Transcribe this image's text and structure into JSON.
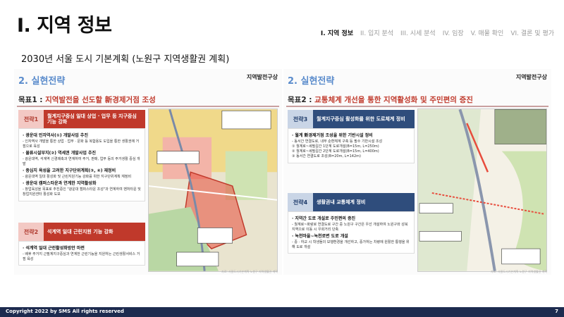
{
  "header": {
    "title": "I. 지역 정보"
  },
  "nav": [
    "I. 지역 정보",
    "II. 입지 분석",
    "III. 시세 분석",
    "IV. 임장",
    "V. 매물 확인",
    "VI. 결론 및 평가"
  ],
  "subtitle": "2030년 서울 도시 기본계획 (노원구 지역생활권 계획)",
  "left": {
    "heading": "2. 실현전략",
    "tag": "지역발전구상",
    "goal_prefix": "목표1 : ",
    "goal_text": "지역발전을 선도할 新경제거점 조성",
    "s1_tag": "전략1",
    "s1_title": "월계지구중심 일대 상업 · 업무 등 지구중심 기능 강화",
    "s1_b1": "· 광운대 민자역사(①) 개발사업 추진",
    "s1_b1d": "- 인자역사 개발을 통한 상업 · 업무 · 문화 등 복합용도 도입을 통한 생활권에 거점으로 육성",
    "s1_b2": "· 물류시설부지(②) 역세권 개발사업 추진",
    "s1_b2d": "- 광운대역, 석계역 신경제축과 연계하여 주거, 판매, 업무 등의 주거생활 중심 개발",
    "s1_b3": "· 중심지 육성을 고려한 지구단위계획(③, ④) 재정비",
    "s1_b3d": "- 광운대역 일대 활성화 및 근린지원기능 강화를 위한 지구단위계획 재정비",
    "s1_b4": "· 광운대 캠퍼스타운과 연계한 지역활성화",
    "s1_b4d": "- 창업육성을 목표로 추진중인 \"광운대 캠퍼스타운 조성\"과 연계하여 벤처타운 및 창업지원센터 활성화 도모",
    "s2_tag": "전략2",
    "s2_title": "석계역 일대 근린지원 기능 강화",
    "s2_b1": "· 석계역 일대 근린활성화방안 마련",
    "s2_b1d": "- 배후 주거지 근필계지구중심과 연계한 근린기능을 지원하는 근린생활서비스 거점 육성"
  },
  "right": {
    "heading": "2. 실현전략",
    "tag": "지역발전구상",
    "goal_prefix": "목표2 : ",
    "goal_text": "교통체계 개선을 통한 지역활성화 및 주민편의 증진",
    "s3_tag": "전략3",
    "s3_title": "월계지구중심 활성화를 위한 도로체계 정비",
    "s3_b1": "· 월계 新경제거점 조성을 위한 기반시설 정비",
    "s3_b1d": "- 동서간 연결도로, 내부 순환체계 구축 등 필수 기반시설 조성",
    "s3_b1e": "① 월계로~세필길간 1단계 도로개설(B=15m, L=250m)",
    "s3_b1f": "② 월계로~세필길간 2단계 도로개설(B=15m, L=400m)",
    "s3_b1g": "③ 동서간 연결도로 조성(B=20m, L=142m)",
    "s4_tag": "전략4",
    "s4_title": "생활권내 교통체계 정비",
    "s4_b1": "· 지역간 도로 개설로 주민편의 증진",
    "s4_b1d": "- 월계로~화랑로 연결도로 구간 중 노원구 구간은 우선 개설하여 노원구와 성북지역으로 이동 시 우회거리 단축",
    "s4_b2": "· 녹천마을~녹천로변 도로 개설",
    "s4_b2d": "- 중 · 하교 시 학생들의 보행환경을 개선하고, 증가하는 차량에 원활한 통행을 위해 도로 개설"
  },
  "footer": {
    "copyright": "Copyright 2022 by SMS All rights reserved",
    "page": "7"
  },
  "source_note": "자료: 서울도시기본계획 노원구 지역생활권 계획"
}
